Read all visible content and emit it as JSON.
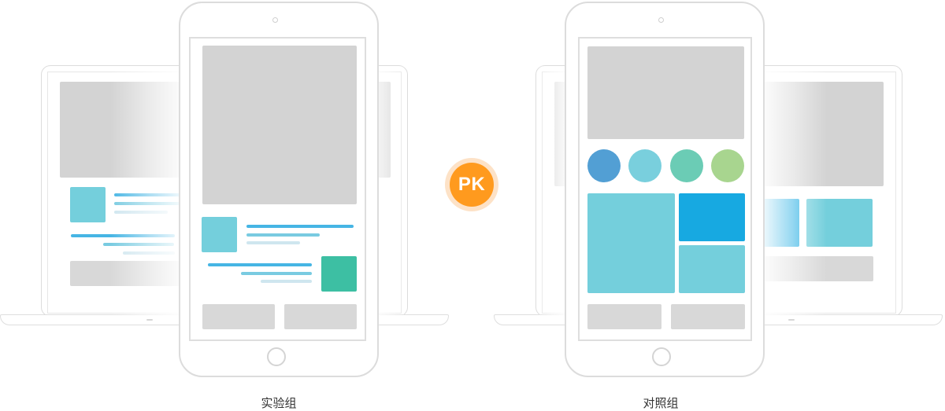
{
  "left_group": {
    "caption": "实验组"
  },
  "right_group": {
    "caption": "对照组"
  },
  "versus": {
    "label": "PK",
    "color": "#ff9a1e"
  },
  "colors": {
    "placeholder_gray": "#d3d3d3",
    "cyan": "#74cfdc",
    "blue": "#17a9e1",
    "teal": "#3dbfa3",
    "circle_blue": "#529fd4",
    "circle_cyan": "#79cfdd",
    "circle_teal": "#6bccb5",
    "circle_green": "#a8d58f"
  }
}
